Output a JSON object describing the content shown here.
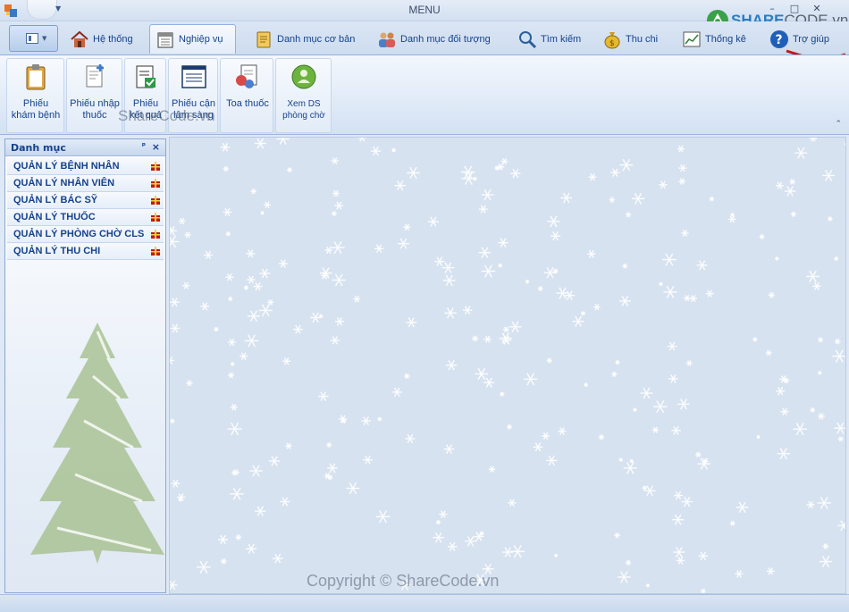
{
  "window": {
    "title": "MENU",
    "minimize": "–",
    "maximize": "□",
    "close": "✕"
  },
  "tabs": [
    {
      "label": "Hệ thống",
      "icon": "house-icon",
      "active": false
    },
    {
      "label": "Nghiệp vụ",
      "icon": "calendar-icon",
      "active": true
    },
    {
      "label": "Danh mục cơ bản",
      "icon": "notepad-icon",
      "active": false
    },
    {
      "label": "Danh mục đối tượng",
      "icon": "people-icon",
      "active": false
    },
    {
      "label": "Tìm kiếm",
      "icon": "magnifier-icon",
      "active": false
    },
    {
      "label": "Thu chi",
      "icon": "money-bag-icon",
      "active": false
    },
    {
      "label": "Thống kê",
      "icon": "chart-icon",
      "active": false
    },
    {
      "label": "Trợ giúp",
      "icon": "help-icon",
      "active": false
    }
  ],
  "ribbon": {
    "buttons": [
      {
        "label": "Phiếu\nkhám bệnh",
        "icon": "clipboard-icon"
      },
      {
        "label": "Phiếu nhập\nthuốc",
        "icon": "document-add-icon"
      },
      {
        "label": "Phiếu\nkết quả",
        "icon": "checklist-icon"
      },
      {
        "label": "Phiếu cận\nlâm sàng",
        "icon": "form-icon"
      },
      {
        "label": "Toa thuốc",
        "icon": "pills-icon"
      },
      {
        "label": "Xem DS\nphòng chờ",
        "icon": "green-orb-icon"
      }
    ],
    "collapse": "⌃"
  },
  "panel": {
    "title": "Danh mục",
    "pin": "ᵖ",
    "close": "×",
    "items": [
      "QUẢN LÝ BỆNH NHÂN",
      "QUẢN LÝ NHÂN VIÊN",
      "QUẢN LÝ BÁC SỸ",
      "QUẢN LÝ THUỐC",
      "QUẢN LÝ PHÒNG CHỜ CLS",
      "QUẢN LÝ THU CHI"
    ]
  },
  "watermarks": {
    "top": "ShareCode.vn",
    "bottom": "Copyright © ShareCode.vn"
  },
  "logo": {
    "brand": "SHARE",
    "rest": "CODE.vn"
  },
  "colors": {
    "accent": "#15428b",
    "ribbon_border": "#8db2e3",
    "background": "#dfe8f5"
  }
}
